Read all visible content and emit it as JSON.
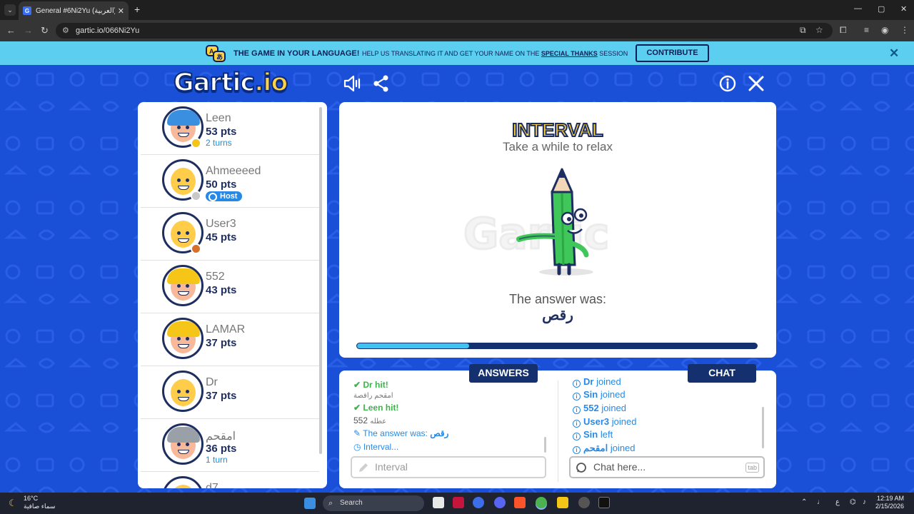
{
  "browser": {
    "tab_title": "General #6Ni2Yu (العربية) - Gar",
    "tab_favicon": "G",
    "url": "gartic.io/066Ni2Yu"
  },
  "banner": {
    "headline": "THE GAME IN YOUR LANGUAGE!",
    "text_before": "HELP US TRANSLATING IT AND GET YOUR NAME ON THE ",
    "special": "SPECIAL THANKS",
    "text_after": " SESSION",
    "contribute_label": "CONTRIBUTE"
  },
  "logo": {
    "main": "Gartic",
    "suffix": ".io"
  },
  "players": [
    {
      "name": "Leen",
      "pts": "53 pts",
      "extra": "2 turns",
      "dot": "#f5c518",
      "hair": "#3b8fe0",
      "skin": "#f8b89a"
    },
    {
      "name": "Ahmeeeed",
      "pts": "50 pts",
      "host": "Host",
      "dot": "#c8c8c8",
      "hair": "",
      "skin": "#ffcd4a"
    },
    {
      "name": "User3",
      "pts": "45 pts",
      "dot": "#d9702a",
      "hair": "",
      "skin": "#ffcd4a"
    },
    {
      "name": "552",
      "pts": "43 pts",
      "dot": "",
      "hair": "#f5c518",
      "skin": "#f8b89a"
    },
    {
      "name": "LAMAR",
      "pts": "37 pts",
      "dot": "",
      "hair": "#f5c518",
      "skin": "#f8b89a"
    },
    {
      "name": "Dr",
      "pts": "37 pts",
      "dot": "",
      "hair": "",
      "skin": "#ffcd4a"
    },
    {
      "name": "امقحم",
      "pts": "36 pts",
      "extra": "1 turn",
      "dot": "",
      "hair": "#9aa0a8",
      "skin": "#f8b89a"
    },
    {
      "name": "d7",
      "pts": "",
      "dot": "",
      "hair": "",
      "skin": "#ffcd4a"
    }
  ],
  "main": {
    "title": "INTERVAL",
    "subtitle": "Take a while to relax",
    "answer_label": "The answer was:",
    "answer_word": "رقص",
    "progress": 0.28
  },
  "answers_tab": "ANSWERS",
  "chat_tab": "CHAT",
  "answers": [
    {
      "type": "hit",
      "text": "Dr hit!"
    },
    {
      "type": "small",
      "text": "امقحم راقصة"
    },
    {
      "type": "hit",
      "text": "Leen hit!"
    },
    {
      "type": "guess",
      "user": "552",
      "text": "عطله"
    },
    {
      "type": "answer",
      "label": "The answer was: ",
      "word": "رقص"
    },
    {
      "type": "interval",
      "text": "Interval..."
    }
  ],
  "answers_placeholder": "Interval",
  "chat": [
    {
      "user": "Dr",
      "text": " joined"
    },
    {
      "user": "Sin",
      "text": " joined"
    },
    {
      "user": "552",
      "text": " joined"
    },
    {
      "user": "User3",
      "text": " joined"
    },
    {
      "user": "Sin",
      "text": " left"
    },
    {
      "user": "امقحم",
      "text": " joined"
    }
  ],
  "chat_placeholder": "Chat here...",
  "chat_tab_key": "tab",
  "taskbar": {
    "temp": "16°C",
    "weather": "سماء صافية",
    "search": "Search",
    "time": "12:19 AM",
    "date": "2/15/2026",
    "lang": "ع"
  }
}
